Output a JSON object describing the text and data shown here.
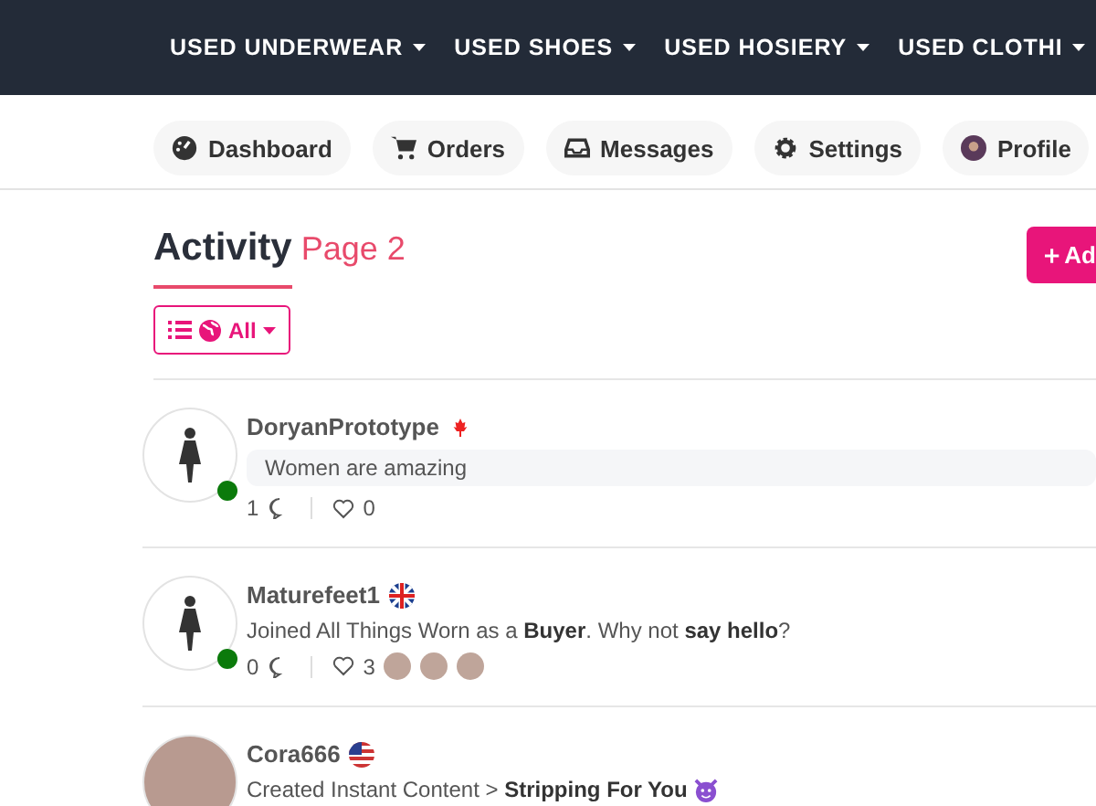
{
  "navbar": {
    "items": [
      {
        "label": "USED UNDERWEAR"
      },
      {
        "label": "USED SHOES"
      },
      {
        "label": "USED HOSIERY"
      },
      {
        "label": "USED CLOTHI"
      }
    ]
  },
  "tabs": [
    {
      "label": "Dashboard",
      "kind": "dashboard"
    },
    {
      "label": "Orders",
      "kind": "orders"
    },
    {
      "label": "Messages",
      "kind": "messages"
    },
    {
      "label": "Settings",
      "kind": "settings"
    },
    {
      "label": "Profile",
      "kind": "profile"
    }
  ],
  "header": {
    "title": "Activity",
    "subtitle": "Page 2",
    "add_button": "Ad"
  },
  "filter": {
    "label": "All"
  },
  "activities": [
    {
      "username": "DoryanPrototype",
      "flag": {
        "kind": "canada"
      },
      "avatar": {
        "kind": "silhouette"
      },
      "online": true,
      "bubble": true,
      "message": "Women are amazing",
      "comments": "1",
      "likes": "0"
    },
    {
      "username": "Maturefeet1",
      "flag": {
        "kind": "uk"
      },
      "avatar": {
        "kind": "silhouette"
      },
      "online": true,
      "bubble": false,
      "message": "Joined All Things Worn as a **Buyer**. Why not **say hello**?",
      "comments": "0",
      "likes": "3",
      "likers": [
        {
          "kind": "photo"
        },
        {
          "kind": "photo"
        },
        {
          "kind": "photo"
        }
      ]
    },
    {
      "username": "Cora666",
      "flag": {
        "kind": "usa"
      },
      "avatar": {
        "kind": "photo"
      },
      "bubble": false,
      "message": "Created Instant Content > **Stripping For You**",
      "emoji": {
        "kind": "devil"
      }
    }
  ]
}
